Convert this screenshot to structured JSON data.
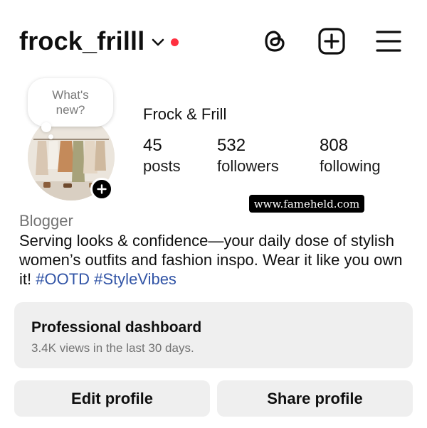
{
  "header": {
    "username": "frock_frilll",
    "icons": [
      "chevron-down-icon",
      "notification-dot",
      "threads-icon",
      "create-post-icon",
      "menu-icon"
    ],
    "notification_color": "#ff3040"
  },
  "profile": {
    "note_text": "What's new?",
    "display_name": "Frock & Frill",
    "stats": [
      {
        "value": "45",
        "label": "posts"
      },
      {
        "value": "532",
        "label": "followers"
      },
      {
        "value": "808",
        "label": "following"
      }
    ],
    "category": "Blogger",
    "bio_text": "Serving looks & confidence—your daily dose of stylish women’s outfits and fashion inspo. Wear it like you own it! ",
    "bio_tags": [
      "#OOTD",
      "#StyleVibes"
    ],
    "tag_color": "#3154a6"
  },
  "watermark": "www.fameheld.com",
  "dashboard": {
    "title": "Professional dashboard",
    "subtitle": "3.4K views in the last 30 days."
  },
  "buttons": {
    "edit": "Edit profile",
    "share": "Share profile"
  }
}
